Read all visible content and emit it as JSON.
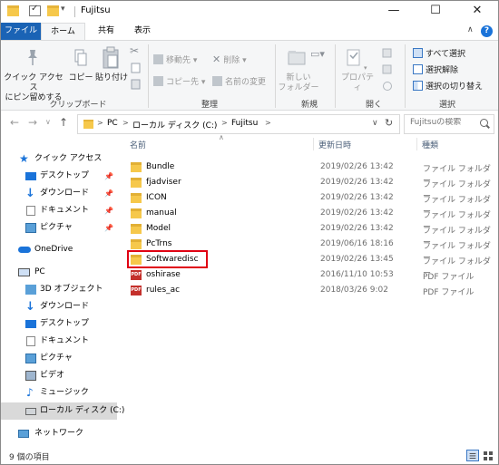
{
  "window": {
    "title": "Fujitsu",
    "controls": {
      "minimize": "—",
      "maximize": "☐",
      "close": "✕"
    }
  },
  "ribbon_tabs": {
    "file": "ファイル",
    "home": "ホーム",
    "share": "共有",
    "view": "表示"
  },
  "ribbon": {
    "clipboard": {
      "label": "クリップボード",
      "pin_quick_access_line1": "クイック アクセス",
      "pin_quick_access_line2": "にピン留めする",
      "copy": "コピー",
      "paste": "貼り付け"
    },
    "organize": {
      "label": "整理",
      "move_to": "移動先",
      "copy_to": "コピー先",
      "delete": "削除",
      "rename": "名前の変更"
    },
    "new": {
      "label": "新規",
      "new_folder_line1": "新しい",
      "new_folder_line2": "フォルダー"
    },
    "open": {
      "label": "開く",
      "properties": "プロパティ"
    },
    "select": {
      "label": "選択",
      "select_all": "すべて選択",
      "select_none": "選択解除",
      "invert": "選択の切り替え"
    }
  },
  "address_bar": {
    "breadcrumbs": [
      "PC",
      "ローカル ディスク (C:)",
      "Fujitsu"
    ],
    "search_placeholder": "Fujitsuの検索"
  },
  "nav_pane": {
    "quick_access": "クイック アクセス",
    "quick_items": [
      "デスクトップ",
      "ダウンロード",
      "ドキュメント",
      "ピクチャ"
    ],
    "onedrive": "OneDrive",
    "pc": "PC",
    "pc_items": [
      "3D オブジェクト",
      "ダウンロード",
      "デスクトップ",
      "ドキュメント",
      "ピクチャ",
      "ビデオ",
      "ミュージック",
      "ローカル ディスク (C:)"
    ],
    "network": "ネットワーク"
  },
  "columns": {
    "name": "名前",
    "modified": "更新日時",
    "type": "種類"
  },
  "files": [
    {
      "name": "Bundle",
      "modified": "2019/02/26 13:42",
      "type": "ファイル フォルダー",
      "kind": "folder"
    },
    {
      "name": "fjadviser",
      "modified": "2019/02/26 13:42",
      "type": "ファイル フォルダー",
      "kind": "folder"
    },
    {
      "name": "ICON",
      "modified": "2019/02/26 13:42",
      "type": "ファイル フォルダー",
      "kind": "folder"
    },
    {
      "name": "manual",
      "modified": "2019/02/26 13:42",
      "type": "ファイル フォルダー",
      "kind": "folder"
    },
    {
      "name": "Model",
      "modified": "2019/02/26 13:42",
      "type": "ファイル フォルダー",
      "kind": "folder"
    },
    {
      "name": "PcTrns",
      "modified": "2019/06/16 18:16",
      "type": "ファイル フォルダー",
      "kind": "folder"
    },
    {
      "name": "Softwaredisc",
      "modified": "2019/02/26 13:45",
      "type": "ファイル フォルダー",
      "kind": "folder"
    },
    {
      "name": "oshirase",
      "modified": "2016/11/10 10:53",
      "type": "PDF ファイル",
      "kind": "pdf"
    },
    {
      "name": "rules_ac",
      "modified": "2018/03/26 9:02",
      "type": "PDF ファイル",
      "kind": "pdf"
    }
  ],
  "status": {
    "item_count": "9 個の項目"
  },
  "colors": {
    "accent": "#1a63b5",
    "highlight_box": "#e00012",
    "folder": "#f6c84b",
    "pdf": "#c4302b"
  }
}
